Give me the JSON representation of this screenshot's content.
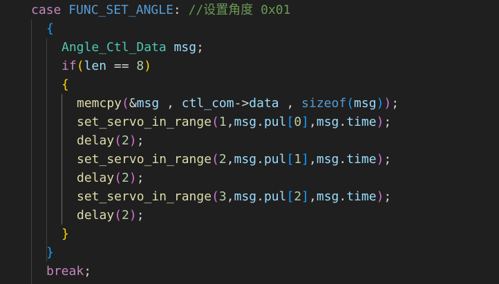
{
  "editor": {
    "colors": {
      "background": "#1f1f1f",
      "keyword": "#569cd6",
      "control": "#c586c0",
      "macro": "#569cd6",
      "type": "#4ec9b0",
      "variable": "#9cdcfe",
      "function": "#dcdcaa",
      "number": "#b5cea8",
      "comment": "#6a9955",
      "punctuation": "#d4d4d4",
      "bracket_gold": "#ffd700",
      "bracket_purple": "#da70d6",
      "bracket_blue": "#179fff"
    },
    "lines": [
      {
        "indent": 1,
        "tokens": [
          {
            "t": "case",
            "c": "control"
          },
          {
            "t": " ",
            "c": "punctuation"
          },
          {
            "t": "FUNC_SET_ANGLE",
            "c": "macro"
          },
          {
            "t": ": ",
            "c": "punctuation"
          },
          {
            "t": "//设置角度 0x01",
            "c": "comment"
          }
        ]
      },
      {
        "indent": 2,
        "tokens": [
          {
            "t": "{",
            "c": "bracket_blue"
          }
        ]
      },
      {
        "indent": 3,
        "tokens": [
          {
            "t": "Angle_Ctl_Data",
            "c": "type"
          },
          {
            "t": " ",
            "c": "punctuation"
          },
          {
            "t": "msg",
            "c": "variable"
          },
          {
            "t": ";",
            "c": "punctuation"
          }
        ]
      },
      {
        "indent": 3,
        "tokens": [
          {
            "t": "if",
            "c": "control"
          },
          {
            "t": "(",
            "c": "bracket_gold"
          },
          {
            "t": "len",
            "c": "variable"
          },
          {
            "t": " == ",
            "c": "punctuation"
          },
          {
            "t": "8",
            "c": "number"
          },
          {
            "t": ")",
            "c": "bracket_gold"
          }
        ]
      },
      {
        "indent": 3,
        "tokens": [
          {
            "t": "{",
            "c": "bracket_gold"
          }
        ]
      },
      {
        "indent": 4,
        "tokens": [
          {
            "t": "memcpy",
            "c": "function"
          },
          {
            "t": "(",
            "c": "bracket_purple"
          },
          {
            "t": "&",
            "c": "punctuation"
          },
          {
            "t": "msg",
            "c": "variable"
          },
          {
            "t": " , ",
            "c": "punctuation"
          },
          {
            "t": "ctl_com",
            "c": "variable"
          },
          {
            "t": "->",
            "c": "punctuation"
          },
          {
            "t": "data",
            "c": "variable"
          },
          {
            "t": " , ",
            "c": "punctuation"
          },
          {
            "t": "sizeof",
            "c": "keyword"
          },
          {
            "t": "(",
            "c": "bracket_blue"
          },
          {
            "t": "msg",
            "c": "variable"
          },
          {
            "t": ")",
            "c": "bracket_blue"
          },
          {
            "t": ")",
            "c": "bracket_purple"
          },
          {
            "t": ";",
            "c": "punctuation"
          }
        ]
      },
      {
        "indent": 4,
        "tokens": [
          {
            "t": "set_servo_in_range",
            "c": "function"
          },
          {
            "t": "(",
            "c": "bracket_purple"
          },
          {
            "t": "1",
            "c": "number"
          },
          {
            "t": ",",
            "c": "punctuation"
          },
          {
            "t": "msg",
            "c": "variable"
          },
          {
            "t": ".",
            "c": "punctuation"
          },
          {
            "t": "pul",
            "c": "variable"
          },
          {
            "t": "[",
            "c": "bracket_blue"
          },
          {
            "t": "0",
            "c": "number"
          },
          {
            "t": "]",
            "c": "bracket_blue"
          },
          {
            "t": ",",
            "c": "punctuation"
          },
          {
            "t": "msg",
            "c": "variable"
          },
          {
            "t": ".",
            "c": "punctuation"
          },
          {
            "t": "time",
            "c": "variable"
          },
          {
            "t": ")",
            "c": "bracket_purple"
          },
          {
            "t": ";",
            "c": "punctuation"
          }
        ]
      },
      {
        "indent": 4,
        "tokens": [
          {
            "t": "delay",
            "c": "function"
          },
          {
            "t": "(",
            "c": "bracket_purple"
          },
          {
            "t": "2",
            "c": "number"
          },
          {
            "t": ")",
            "c": "bracket_purple"
          },
          {
            "t": ";",
            "c": "punctuation"
          }
        ]
      },
      {
        "indent": 4,
        "tokens": [
          {
            "t": "set_servo_in_range",
            "c": "function"
          },
          {
            "t": "(",
            "c": "bracket_purple"
          },
          {
            "t": "2",
            "c": "number"
          },
          {
            "t": ",",
            "c": "punctuation"
          },
          {
            "t": "msg",
            "c": "variable"
          },
          {
            "t": ".",
            "c": "punctuation"
          },
          {
            "t": "pul",
            "c": "variable"
          },
          {
            "t": "[",
            "c": "bracket_blue"
          },
          {
            "t": "1",
            "c": "number"
          },
          {
            "t": "]",
            "c": "bracket_blue"
          },
          {
            "t": ",",
            "c": "punctuation"
          },
          {
            "t": "msg",
            "c": "variable"
          },
          {
            "t": ".",
            "c": "punctuation"
          },
          {
            "t": "time",
            "c": "variable"
          },
          {
            "t": ")",
            "c": "bracket_purple"
          },
          {
            "t": ";",
            "c": "punctuation"
          }
        ]
      },
      {
        "indent": 4,
        "tokens": [
          {
            "t": "delay",
            "c": "function"
          },
          {
            "t": "(",
            "c": "bracket_purple"
          },
          {
            "t": "2",
            "c": "number"
          },
          {
            "t": ")",
            "c": "bracket_purple"
          },
          {
            "t": ";",
            "c": "punctuation"
          }
        ]
      },
      {
        "indent": 4,
        "tokens": [
          {
            "t": "set_servo_in_range",
            "c": "function"
          },
          {
            "t": "(",
            "c": "bracket_purple"
          },
          {
            "t": "3",
            "c": "number"
          },
          {
            "t": ",",
            "c": "punctuation"
          },
          {
            "t": "msg",
            "c": "variable"
          },
          {
            "t": ".",
            "c": "punctuation"
          },
          {
            "t": "pul",
            "c": "variable"
          },
          {
            "t": "[",
            "c": "bracket_blue"
          },
          {
            "t": "2",
            "c": "number"
          },
          {
            "t": "]",
            "c": "bracket_blue"
          },
          {
            "t": ",",
            "c": "punctuation"
          },
          {
            "t": "msg",
            "c": "variable"
          },
          {
            "t": ".",
            "c": "punctuation"
          },
          {
            "t": "time",
            "c": "variable"
          },
          {
            "t": ")",
            "c": "bracket_purple"
          },
          {
            "t": ";",
            "c": "punctuation"
          }
        ]
      },
      {
        "indent": 4,
        "tokens": [
          {
            "t": "delay",
            "c": "function"
          },
          {
            "t": "(",
            "c": "bracket_purple"
          },
          {
            "t": "2",
            "c": "number"
          },
          {
            "t": ")",
            "c": "bracket_purple"
          },
          {
            "t": ";",
            "c": "punctuation"
          }
        ]
      },
      {
        "indent": 3,
        "tokens": [
          {
            "t": "}",
            "c": "bracket_gold"
          }
        ]
      },
      {
        "indent": 2,
        "tokens": [
          {
            "t": "}",
            "c": "bracket_blue"
          }
        ]
      },
      {
        "indent": 2,
        "tokens": [
          {
            "t": "break",
            "c": "control"
          },
          {
            "t": ";",
            "c": "punctuation"
          }
        ]
      }
    ]
  }
}
